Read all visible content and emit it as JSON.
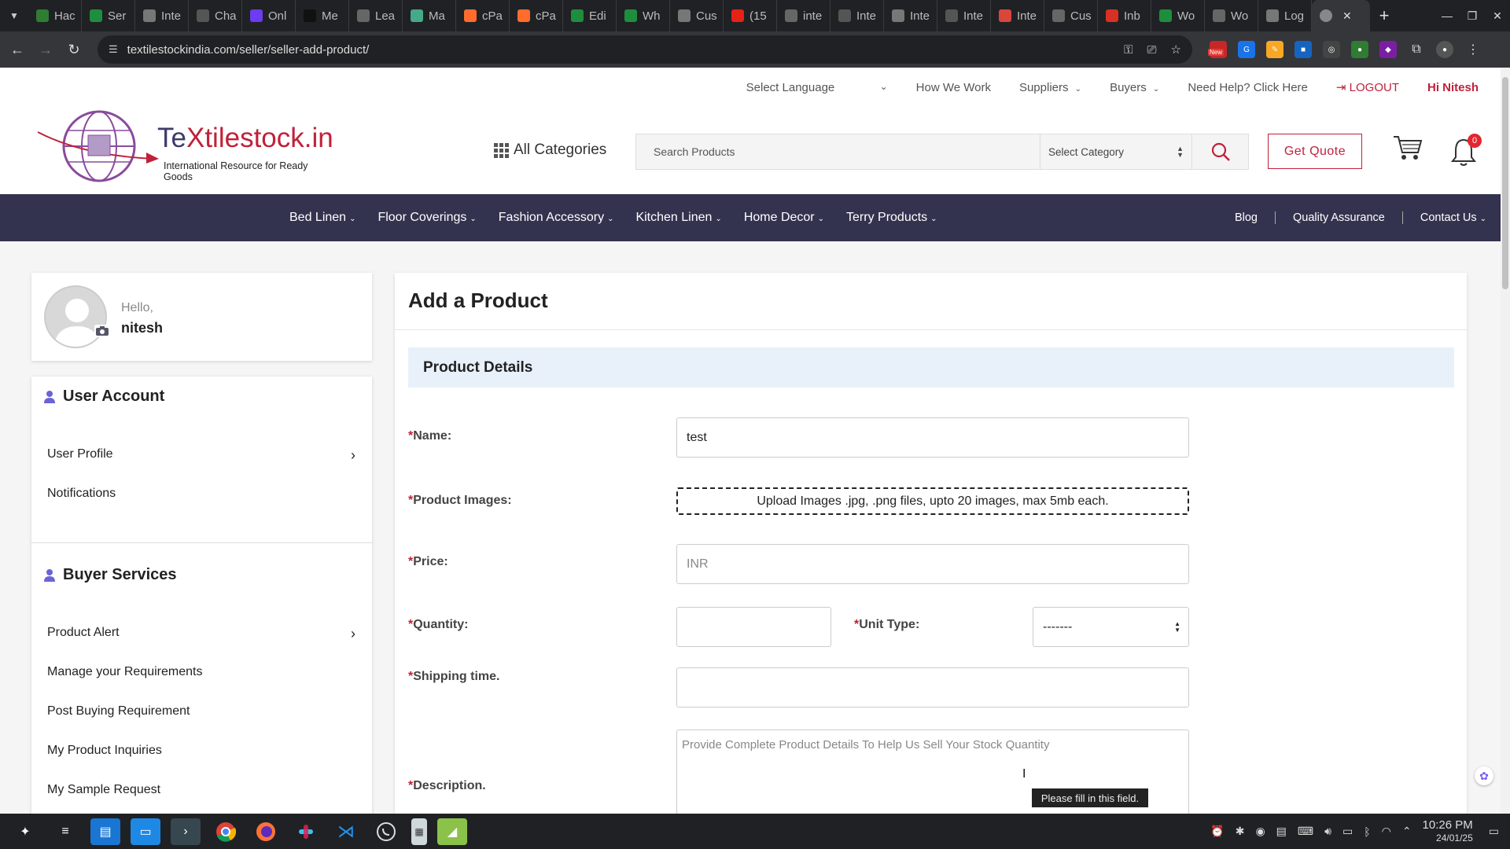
{
  "browser": {
    "tabs": [
      {
        "label": "Hac",
        "color": "#2e7d32"
      },
      {
        "label": "Ser",
        "color": "#1e8e3e"
      },
      {
        "label": "Inte",
        "color": "#777"
      },
      {
        "label": "Cha",
        "color": "#555"
      },
      {
        "label": "Onl",
        "color": "#6a3df0"
      },
      {
        "label": "Me",
        "color": "#111"
      },
      {
        "label": "Lea",
        "color": "#666"
      },
      {
        "label": "Ma",
        "color": "#4a8"
      },
      {
        "label": "cPa",
        "color": "#ff6c2c"
      },
      {
        "label": "cPa",
        "color": "#ff6c2c"
      },
      {
        "label": "Edi",
        "color": "#1e8e3e"
      },
      {
        "label": "Wh",
        "color": "#1e8e3e"
      },
      {
        "label": "Cus",
        "color": "#777"
      },
      {
        "label": "(15",
        "color": "#e62117"
      },
      {
        "label": "inte",
        "color": "#666"
      },
      {
        "label": "Inte",
        "color": "#555"
      },
      {
        "label": "Inte",
        "color": "#777"
      },
      {
        "label": "Inte",
        "color": "#555"
      },
      {
        "label": "Inte",
        "color": "#d9473b"
      },
      {
        "label": "Cus",
        "color": "#666"
      },
      {
        "label": "Inb",
        "color": "#d93025"
      },
      {
        "label": "Wo",
        "color": "#1e8e3e"
      },
      {
        "label": "Wo",
        "color": "#666"
      },
      {
        "label": "Log",
        "color": "#777"
      }
    ],
    "new_tab": "+",
    "url": "textilestockindia.com/seller/seller-add-product/",
    "new_badge": "New"
  },
  "header": {
    "language": "Select Language",
    "how_we_work": "How We Work",
    "suppliers": "Suppliers",
    "buyers": "Buyers",
    "help": "Need Help? Click Here",
    "logout": "LOGOUT",
    "greeting": "Hi Nitesh",
    "logo_prefix": "Te",
    "logo_x": "X",
    "logo_rest": "tilestock.in",
    "logo_tagline": "International Resource for Ready Goods",
    "all_categories": "All Categories",
    "search_placeholder": "Search Products",
    "select_category": "Select Category",
    "get_quote": "Get Quote",
    "notification_count": "0"
  },
  "nav": {
    "items": [
      "Bed Linen",
      "Floor Coverings",
      "Fashion Accessory",
      "Kitchen Linen",
      "Home Decor",
      "Terry Products"
    ],
    "right": [
      "Blog",
      "Quality Assurance",
      "Contact Us"
    ]
  },
  "profile": {
    "hello": "Hello,",
    "name": "nitesh"
  },
  "sidebar": {
    "user_account": "User Account",
    "user_items": [
      "User Profile",
      "Notifications"
    ],
    "buyer_services": "Buyer Services",
    "buyer_items": [
      "Product Alert",
      "Manage your Requirements",
      "Post Buying Requirement",
      "My Product Inquiries",
      "My Sample Request"
    ]
  },
  "form": {
    "title": "Add a Product",
    "section": "Product Details",
    "required_mark": "*",
    "name_label": "Name:",
    "name_value": "test",
    "images_label": "Product Images:",
    "upload_text": "Upload Images .jpg, .png files, upto 20 images, max 5mb each.",
    "price_label": "Price:",
    "price_placeholder": "INR",
    "quantity_label": "Quantity:",
    "unit_type_label": "Unit Type:",
    "unit_type_value": "-------",
    "shipping_label": "Shipping time.",
    "description_label": "Description.",
    "description_placeholder": "Provide Complete Product Details To Help Us Sell Your Stock Quantity",
    "tooltip": "Please fill in this field."
  },
  "taskbar": {
    "time": "10:26 PM",
    "date": "24/01/25"
  },
  "colors": {
    "brand_red": "#c0213a",
    "nav_bg": "#33334f",
    "section_bg": "#e8f1f9"
  }
}
